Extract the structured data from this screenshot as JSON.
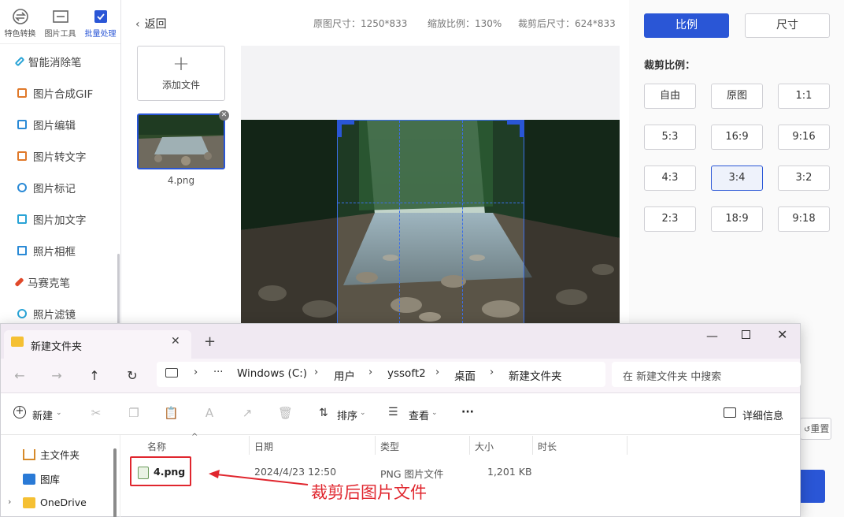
{
  "sidebar": {
    "top_tabs": [
      {
        "label": "特色转换",
        "icon": "swap-icon",
        "active": false
      },
      {
        "label": "图片工具",
        "icon": "image-tool-icon",
        "active": false
      },
      {
        "label": "批量处理",
        "icon": "batch-icon",
        "active": true
      }
    ],
    "items": [
      {
        "label": "智能消除笔",
        "icon": "eraser-pen-icon",
        "color": "#2aa4d6"
      },
      {
        "label": "图片合成GIF",
        "icon": "gif-icon",
        "color": "#e0792a"
      },
      {
        "label": "图片编辑",
        "icon": "edit-image-icon",
        "color": "#2a8ad6"
      },
      {
        "label": "图片转文字",
        "icon": "image-to-text-icon",
        "color": "#e0792a"
      },
      {
        "label": "图片标记",
        "icon": "marker-icon",
        "color": "#2a8ad6"
      },
      {
        "label": "图片加文字",
        "icon": "add-text-icon",
        "color": "#2aa4d6"
      },
      {
        "label": "照片相框",
        "icon": "frame-icon",
        "color": "#2a8ad6"
      },
      {
        "label": "马赛克笔",
        "icon": "mosaic-pen-icon",
        "color": "#e0492a"
      },
      {
        "label": "照片滤镜",
        "icon": "filter-icon",
        "color": "#2aa4d6"
      }
    ]
  },
  "main": {
    "back_label": "返回",
    "original_size": "原图尺寸：1250*833",
    "zoom": "缩放比例：130%",
    "cropped_size": "裁剪后尺寸：624*833",
    "add_file_label": "添加文件",
    "thumb_name": "4.png"
  },
  "right_panel": {
    "tab_ratio": "比例",
    "tab_size": "尺寸",
    "crop_ratio_label": "裁剪比例：",
    "ratios": [
      "自由",
      "原图",
      "1:1",
      "5:3",
      "16:9",
      "9:16",
      "4:3",
      "3:4",
      "3:2",
      "2:3",
      "18:9",
      "9:18"
    ],
    "selected_ratio": "3:4",
    "reset_label": "重置"
  },
  "explorer": {
    "tab_title": "新建文件夹",
    "path": [
      "Windows (C:)",
      "用户",
      "yssoft2",
      "桌面",
      "新建文件夹"
    ],
    "path_ellipsis": "···",
    "search_placeholder": "在 新建文件夹 中搜索",
    "toolbar": {
      "new_label": "新建",
      "sort_label": "排序",
      "view_label": "查看",
      "more_label": "···",
      "details_label": "详细信息"
    },
    "columns": [
      "名称",
      "日期",
      "类型",
      "大小",
      "时长"
    ],
    "nav_items": [
      {
        "label": "主文件夹",
        "icon": "home-icon"
      },
      {
        "label": "图库",
        "icon": "gallery-icon"
      },
      {
        "label": "OneDrive",
        "icon": "folder-icon"
      }
    ],
    "file": {
      "name": "4.png",
      "date": "2024/4/23 12:50",
      "type": "PNG 图片文件",
      "size": "1,201 KB"
    },
    "annotation": "裁剪后图片文件",
    "accent_color": "#e0262e"
  }
}
